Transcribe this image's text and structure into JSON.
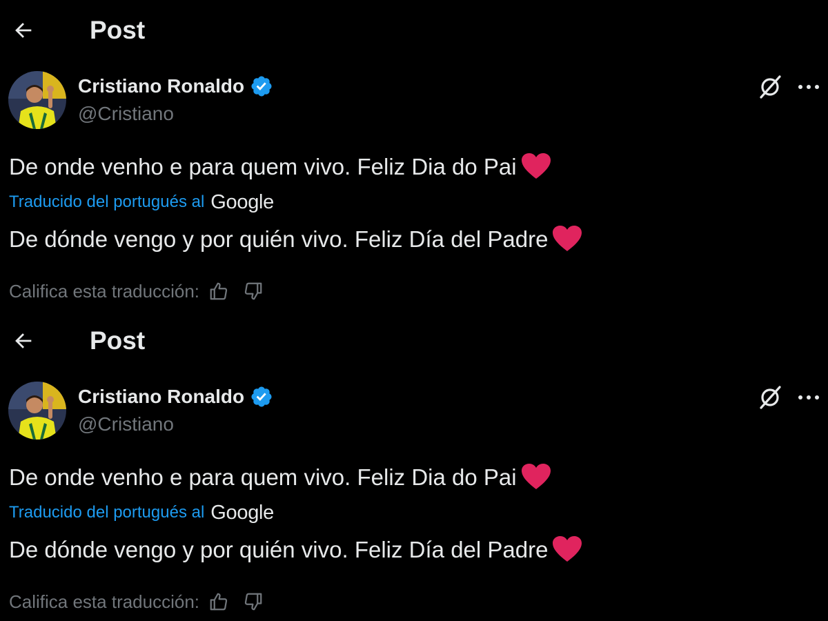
{
  "colors": {
    "background": "#000000",
    "text_primary": "#e7e9ea",
    "text_secondary": "#71767b",
    "link_blue": "#1d9bf0",
    "verified_blue": "#1d9bf0",
    "heart_red": "#e0245e"
  },
  "posts": [
    {
      "header": {
        "title": "Post",
        "back_icon": "arrow-left-icon"
      },
      "author": {
        "name": "Cristiano Ronaldo",
        "handle": "@Cristiano",
        "verified_icon": "verified-badge-icon"
      },
      "actions": {
        "grok_icon": "grok-icon",
        "more_icon": "more-horizontal-icon"
      },
      "text": "De onde venho e para quem vivo. Feliz Dia do Pai",
      "emoji": "heart-icon",
      "translation": {
        "label": "Traducido del portugués al",
        "provider": "Google",
        "text": "De dónde vengo y por quién vivo. Feliz Día del Padre",
        "rate_label": "Califica esta traducción:",
        "thumb_up_icon": "thumb-up-icon",
        "thumb_down_icon": "thumb-down-icon"
      }
    },
    {
      "header": {
        "title": "Post",
        "back_icon": "arrow-left-icon"
      },
      "author": {
        "name": "Cristiano Ronaldo",
        "handle": "@Cristiano",
        "verified_icon": "verified-badge-icon"
      },
      "actions": {
        "grok_icon": "grok-icon",
        "more_icon": "more-horizontal-icon"
      },
      "text": "De onde venho e para quem vivo. Feliz Dia do Pai",
      "emoji": "heart-icon",
      "translation": {
        "label": "Traducido del portugués al",
        "provider": "Google",
        "text": "De dónde vengo y por quién vivo. Feliz Día del Padre",
        "rate_label": "Califica esta traducción:",
        "thumb_up_icon": "thumb-up-icon",
        "thumb_down_icon": "thumb-down-icon"
      }
    }
  ]
}
